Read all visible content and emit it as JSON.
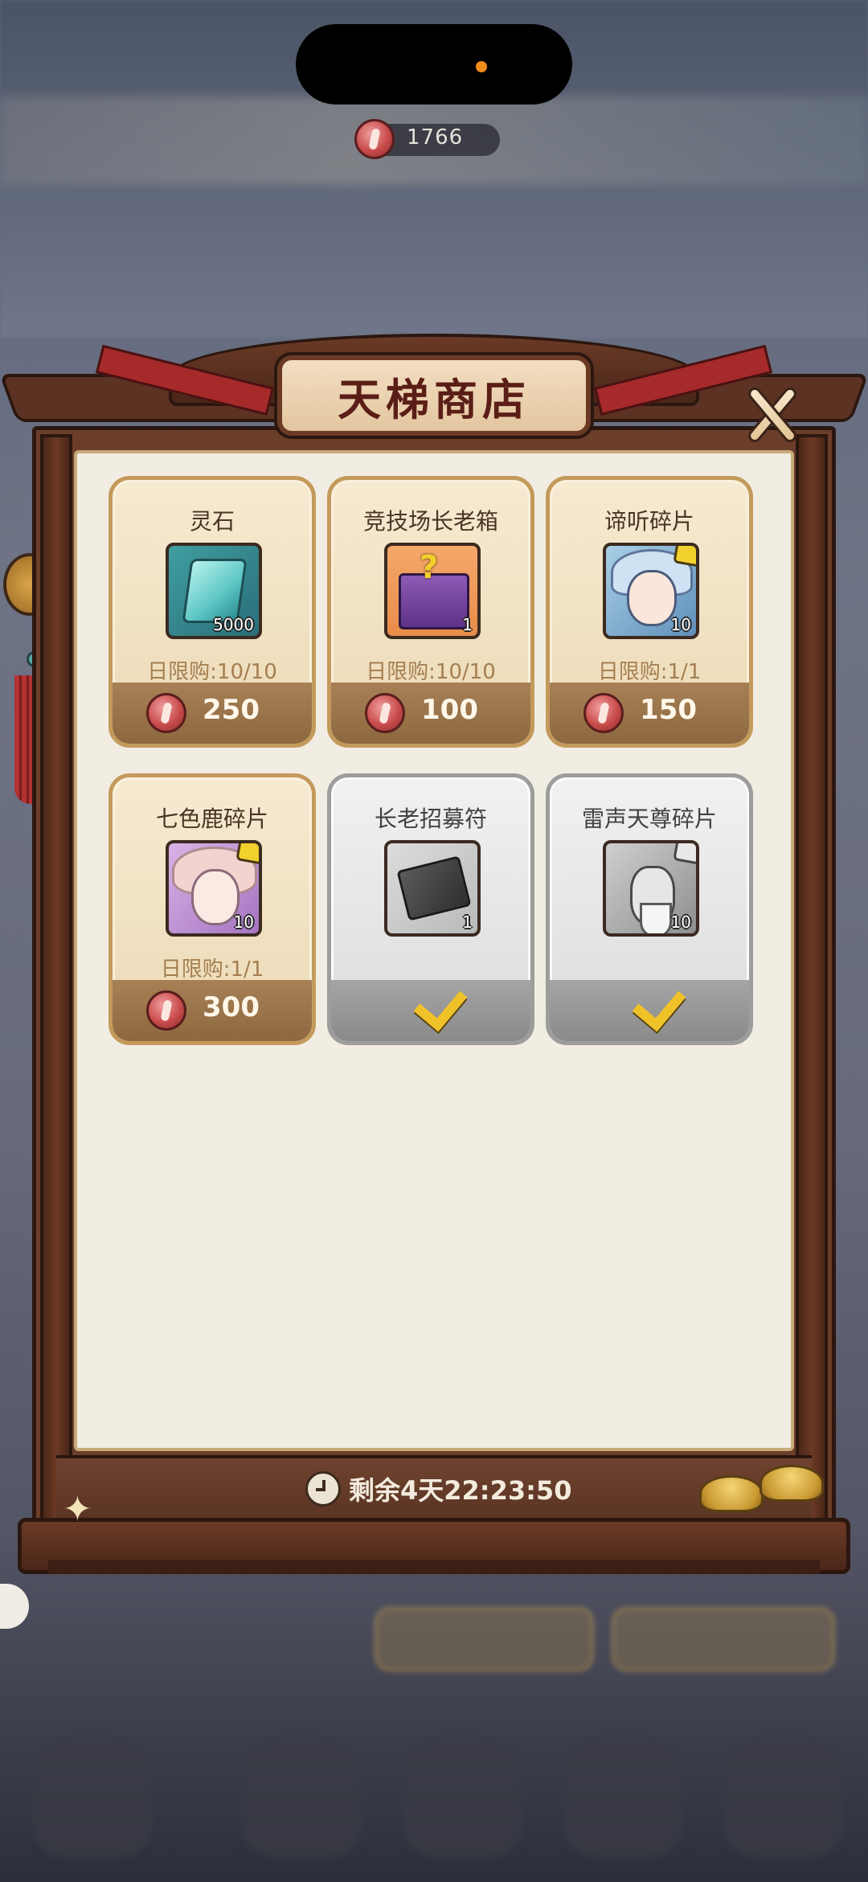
{
  "currency": {
    "amount": "1766"
  },
  "shop": {
    "title": "天梯商店",
    "timer": "剩余4天22:23:50",
    "items": [
      {
        "name": "灵石",
        "qty": "5000",
        "limit": "日限购:10/10",
        "price": "250",
        "sold_out": false
      },
      {
        "name": "竞技场长老箱",
        "qty": "1",
        "limit": "日限购:10/10",
        "price": "100",
        "sold_out": false
      },
      {
        "name": "谛听碎片",
        "qty": "10",
        "limit": "日限购:1/1",
        "price": "150",
        "sold_out": false
      },
      {
        "name": "七色鹿碎片",
        "qty": "10",
        "limit": "日限购:1/1",
        "price": "300",
        "sold_out": false
      },
      {
        "name": "长老招募符",
        "qty": "1",
        "limit": "",
        "price": "",
        "sold_out": true
      },
      {
        "name": "雷声天尊碎片",
        "qty": "10",
        "limit": "",
        "price": "",
        "sold_out": true
      }
    ]
  },
  "colors": {
    "frame_wood": "#6b3e2a",
    "card_gold": "#c49a5c",
    "price_coin": "#c94c4c",
    "checkmark": "#f0c22a"
  }
}
